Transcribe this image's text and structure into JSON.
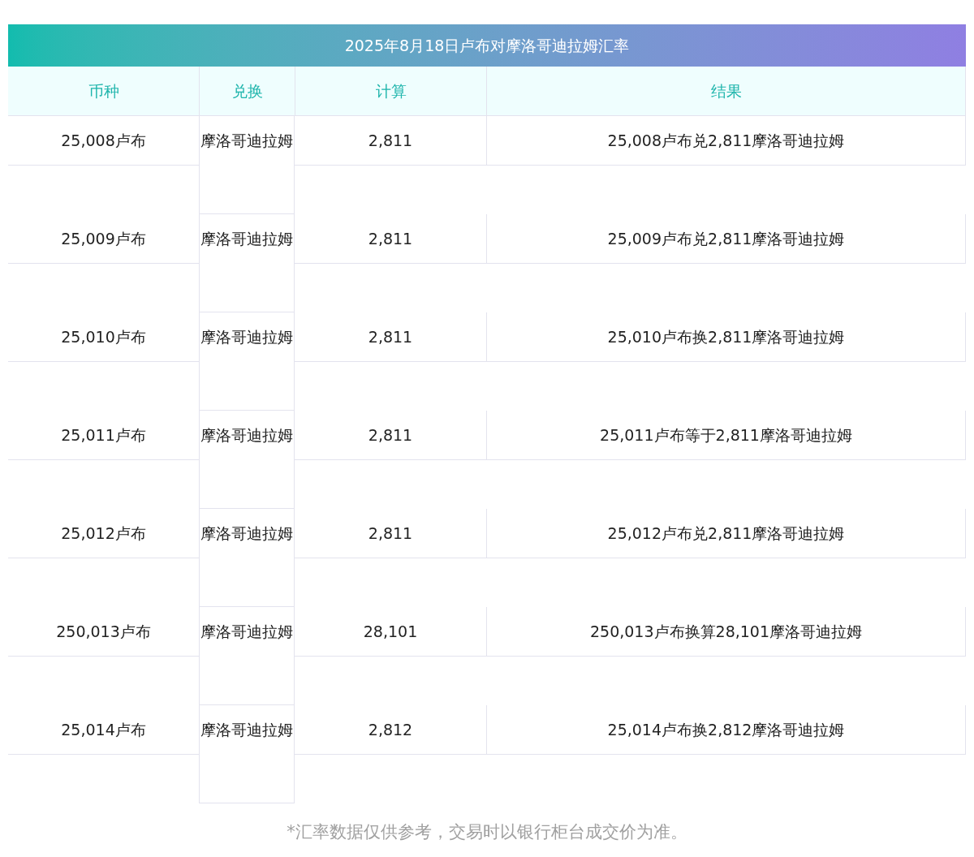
{
  "title": "2025年8月18日卢布对摩洛哥迪拉姆汇率",
  "columns": [
    "币种",
    "兑换",
    "计算",
    "结果"
  ],
  "rows": [
    {
      "currency": "25,008卢布",
      "target": "摩洛哥迪拉姆",
      "calc": "2,811",
      "result": "25,008卢布兑2,811摩洛哥迪拉姆"
    },
    {
      "currency": "25,009卢布",
      "target": "摩洛哥迪拉姆",
      "calc": "2,811",
      "result": "25,009卢布兑2,811摩洛哥迪拉姆"
    },
    {
      "currency": "25,010卢布",
      "target": "摩洛哥迪拉姆",
      "calc": "2,811",
      "result": "25,010卢布换2,811摩洛哥迪拉姆"
    },
    {
      "currency": "25,011卢布",
      "target": "摩洛哥迪拉姆",
      "calc": "2,811",
      "result": "25,011卢布等于2,811摩洛哥迪拉姆"
    },
    {
      "currency": "25,012卢布",
      "target": "摩洛哥迪拉姆",
      "calc": "2,811",
      "result": "25,012卢布兑2,811摩洛哥迪拉姆"
    },
    {
      "currency": "250,013卢布",
      "target": "摩洛哥迪拉姆",
      "calc": "28,101",
      "result": "250,013卢布换算28,101摩洛哥迪拉姆"
    },
    {
      "currency": "25,014卢布",
      "target": "摩洛哥迪拉姆",
      "calc": "2,812",
      "result": "25,014卢布换2,812摩洛哥迪拉姆"
    }
  ],
  "note": "*汇率数据仅供参考，交易时以银行柜台成交价为准。"
}
